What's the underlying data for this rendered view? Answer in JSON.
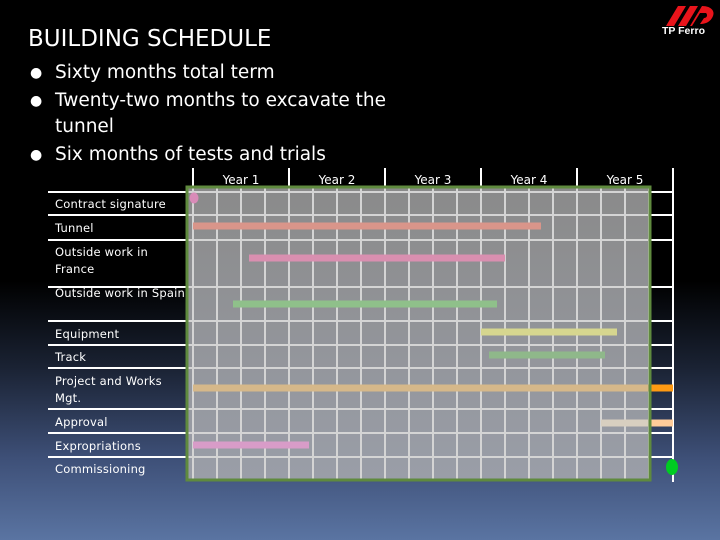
{
  "slide": {
    "title": "BUILDING SCHEDULE",
    "bullets": [
      "Sixty months total term",
      "Twenty-two months to excavate the tunnel",
      "Six months of tests and trials"
    ],
    "logo": {
      "icon": "tp-ferro-logo-icon",
      "text": "TP Ferro",
      "color": "#e8141b"
    }
  },
  "chart_data": {
    "type": "gantt",
    "title": "",
    "time_unit": "month",
    "x_range": [
      0,
      60
    ],
    "periods": [
      "Year 1",
      "Year 2",
      "Year 3",
      "Year 4",
      "Year 5"
    ],
    "grid": true,
    "grid_interval_months": 3,
    "tasks": [
      {
        "name": "Contract signature",
        "type": "milestone",
        "at": 0,
        "color": "#d98bb8"
      },
      {
        "name": "Tunnel",
        "type": "bar",
        "start": 0,
        "end": 43.5,
        "color": "#d9958a"
      },
      {
        "name": "Outside work in France",
        "type": "bar",
        "start": 7,
        "end": 39,
        "color": "#d98fb0"
      },
      {
        "name": "Outside work in Spain",
        "type": "bar",
        "start": 5,
        "end": 38,
        "color": "#8fc08a"
      },
      {
        "name": "Equipment",
        "type": "bar",
        "start": 36,
        "end": 53,
        "color": "#d6d68f"
      },
      {
        "name": "Track",
        "type": "bar",
        "start": 37,
        "end": 51.5,
        "color": "#8fb88a"
      },
      {
        "name": "Project and Works Mgt.",
        "type": "bar",
        "start": 0,
        "end": 60,
        "color": "#d6b88a",
        "tail_color": "#ff9a12"
      },
      {
        "name": "Approval",
        "type": "bar",
        "start": 51,
        "end": 60,
        "color": "#d8cfc0",
        "tail_color": "#ffcc99"
      },
      {
        "name": "Expropriations",
        "type": "bar",
        "start": 0,
        "end": 14.5,
        "color": "#d89cc8"
      },
      {
        "name": "Commissioning",
        "type": "milestone",
        "at": 60,
        "color": "#00cc22"
      }
    ]
  }
}
